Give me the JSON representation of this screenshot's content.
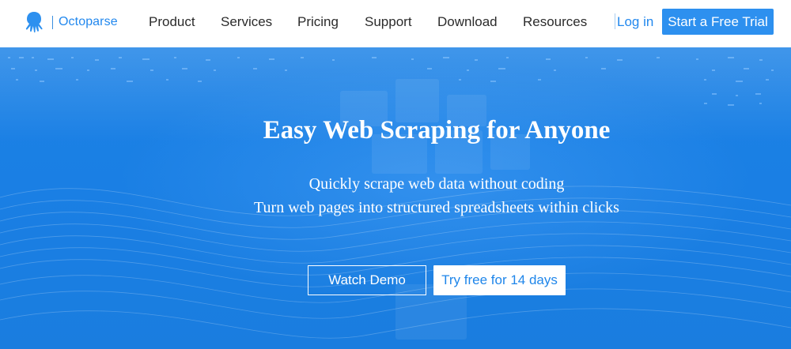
{
  "header": {
    "logo_text": "Octoparse",
    "nav": [
      {
        "label": "Product"
      },
      {
        "label": "Services"
      },
      {
        "label": "Pricing"
      },
      {
        "label": "Support"
      },
      {
        "label": "Download"
      },
      {
        "label": "Resources"
      }
    ],
    "login_label": "Log in",
    "trial_label": "Start a Free Trial"
  },
  "hero": {
    "title": "Easy Web Scraping for Anyone",
    "subtitle_line1": "Quickly scrape web data without coding",
    "subtitle_line2": "Turn web pages into structured spreadsheets within clicks",
    "watch_demo_label": "Watch Demo",
    "try_free_label": "Try free for 14 days"
  },
  "colors": {
    "brand_blue": "#2d90ef",
    "hero_blue": "#1a7fe4",
    "nav_text": "#2b2b2b"
  },
  "icons": [
    "octopus-logo-icon"
  ]
}
